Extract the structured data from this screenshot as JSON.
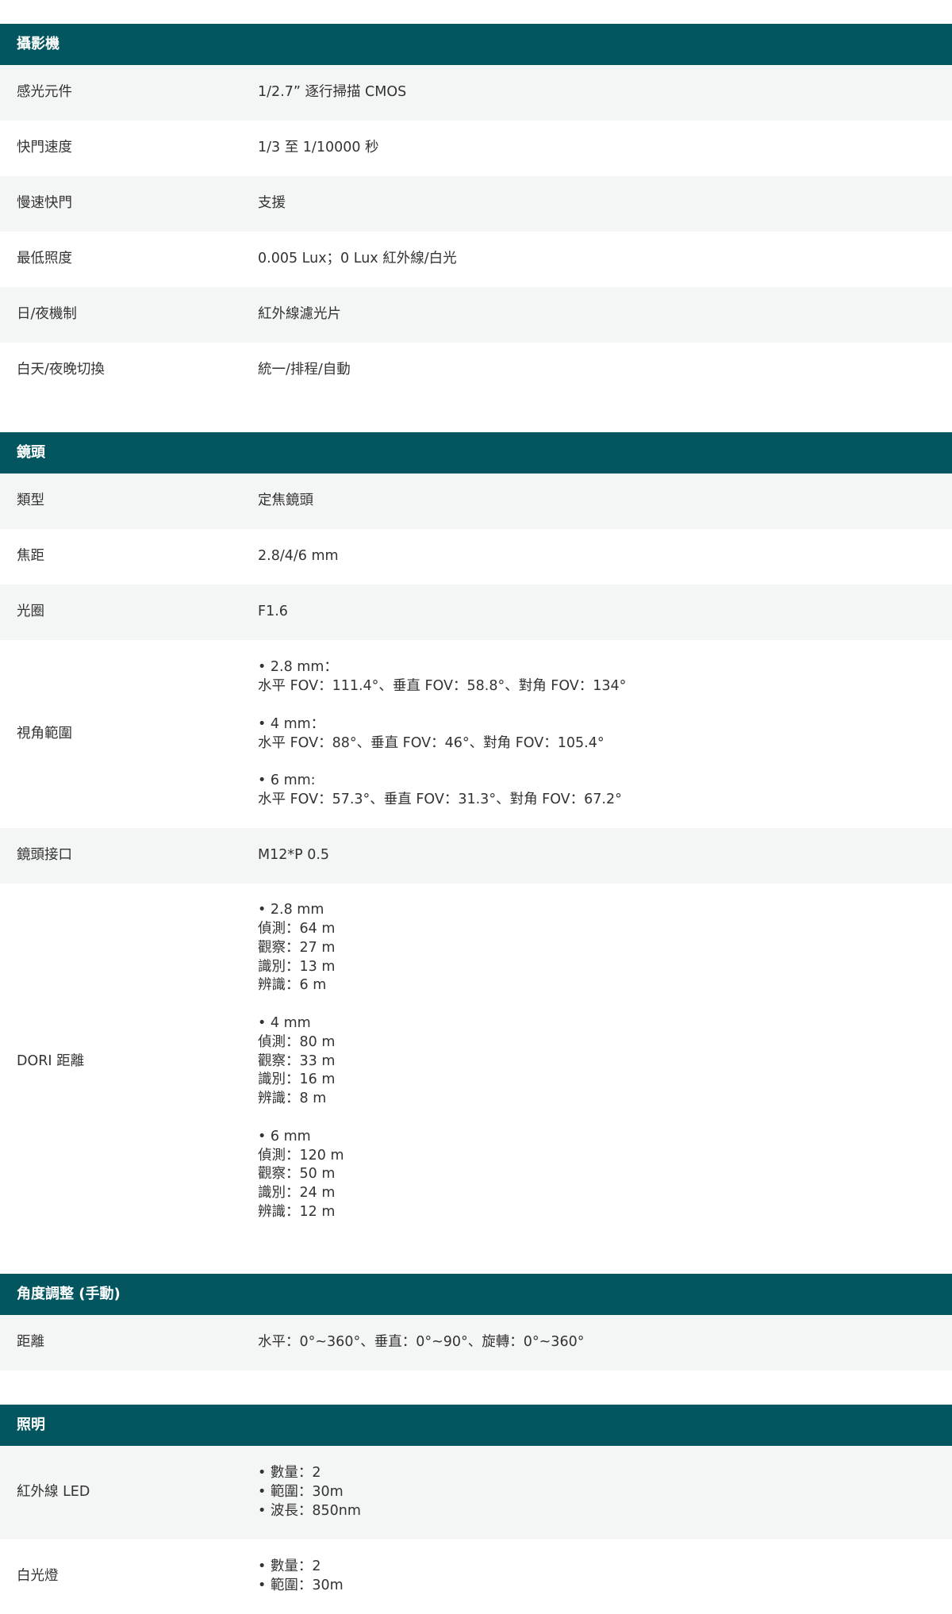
{
  "sections": [
    {
      "title": "攝影機",
      "rows": [
        {
          "label": "感光元件",
          "value": "1/2.7” 逐行掃描 CMOS"
        },
        {
          "label": "快門速度",
          "value": "1/3 至 1/10000 秒"
        },
        {
          "label": "慢速快門",
          "value": "支援"
        },
        {
          "label": "最低照度",
          "value": "0.005 Lux；0 Lux 紅外線/白光"
        },
        {
          "label": "日/夜機制",
          "value": "紅外線濾光片"
        },
        {
          "label": "白天/夜晚切換",
          "value": "統一/排程/自動"
        }
      ]
    },
    {
      "title": "鏡頭",
      "rows": [
        {
          "label": "類型",
          "value": "定焦鏡頭"
        },
        {
          "label": "焦距",
          "value": "2.8/4/6 mm"
        },
        {
          "label": "光圈",
          "value": "F1.6"
        },
        {
          "label": "視角範圍",
          "value": "• 2.8 mm：\n水平 FOV：111.4°、垂直 FOV：58.8°、對角 FOV：134°\n\n• 4 mm：\n水平 FOV：88°、垂直 FOV：46°、對角 FOV：105.4°\n\n• 6 mm:\n水平 FOV：57.3°、垂直 FOV：31.3°、對角 FOV：67.2°"
        },
        {
          "label": "鏡頭接口",
          "value": "M12*P 0.5"
        },
        {
          "label": "DORI 距離",
          "value": "• 2.8 mm\n偵測：64 m\n觀察：27 m\n識別：13 m\n辨識：6 m\n\n• 4 mm\n偵測：80 m\n觀察：33 m\n識別：16 m\n辨識：8 m\n\n• 6 mm\n偵測：120 m\n觀察：50 m\n識別：24 m\n辨識：12 m"
        }
      ]
    },
    {
      "title": "角度調整 (手動)",
      "rows": [
        {
          "label": "距離",
          "value": "水平：0°~360°、垂直：0°~90°、旋轉：0°~360°"
        }
      ]
    },
    {
      "title": "照明",
      "rows": [
        {
          "label": "紅外線 LED",
          "value": "• 數量：2\n• 範圍：30m\n• 波長：850nm"
        },
        {
          "label": "白光燈",
          "value": "• 數量：2\n• 範圍：30m"
        }
      ]
    }
  ]
}
